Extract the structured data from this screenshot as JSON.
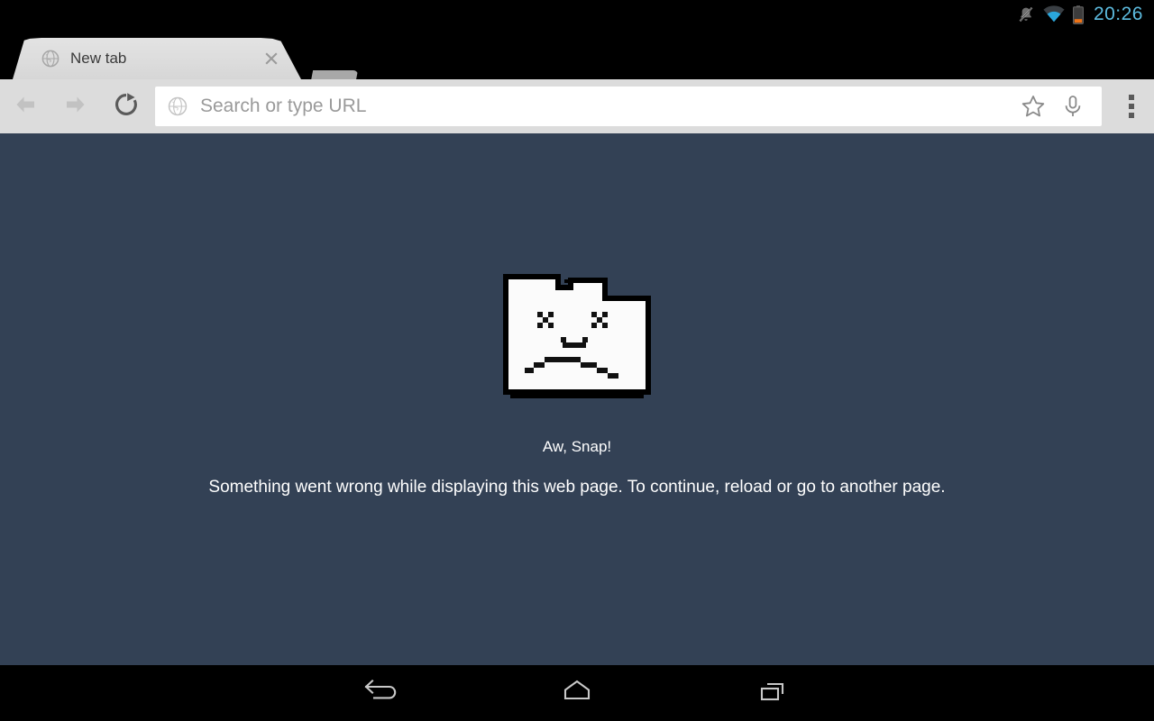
{
  "status_bar": {
    "clock": "20:26",
    "clock_color": "#5DBCE0",
    "icons": [
      {
        "name": "ringer-muted-icon",
        "label": "Ringer muted"
      },
      {
        "name": "wifi-icon",
        "label": "Wi-Fi connected"
      },
      {
        "name": "battery-low-icon",
        "label": "Battery low"
      }
    ]
  },
  "tab_strip": {
    "active_tab": {
      "title": "New tab",
      "favicon": "globe-icon",
      "close_label": "×"
    },
    "new_tab_button": {
      "label": "New tab"
    }
  },
  "toolbar": {
    "back_label": "Back",
    "back_enabled": false,
    "forward_label": "Forward",
    "forward_enabled": false,
    "reload_label": "Reload",
    "reload_enabled": true,
    "omnibox": {
      "value": "",
      "placeholder": "Search or type URL",
      "leading_icon": "globe-icon"
    },
    "bookmark_label": "Bookmark",
    "voice_search_label": "Voice search",
    "menu_label": "Menu"
  },
  "page": {
    "background_color": "#334155",
    "illustration": "sad-folder-icon",
    "title": "Aw, Snap!",
    "message": "Something went wrong while displaying this web page. To continue, reload or go to another page."
  },
  "nav_bar": {
    "back_label": "Back",
    "home_label": "Home",
    "recents_label": "Recent apps"
  }
}
